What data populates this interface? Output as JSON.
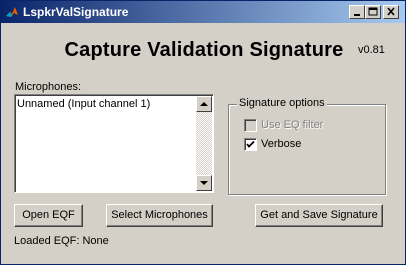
{
  "window": {
    "title": "LspkrValSignature"
  },
  "header": {
    "title": "Capture Validation Signature",
    "version": "v0.81"
  },
  "microphones": {
    "label": "Microphones:",
    "items": [
      "Unnamed (Input channel 1)"
    ]
  },
  "signature_options": {
    "title": "Signature options",
    "use_eq_filter": {
      "label": "Use EQ filter",
      "checked": false,
      "enabled": false
    },
    "verbose": {
      "label": "Verbose",
      "checked": true,
      "enabled": true
    }
  },
  "buttons": {
    "open_eqf": "Open EQF",
    "select_microphones": "Select Microphones",
    "get_and_save": "Get and Save Signature"
  },
  "status": {
    "loaded_eqf": "Loaded EQF: None"
  }
}
